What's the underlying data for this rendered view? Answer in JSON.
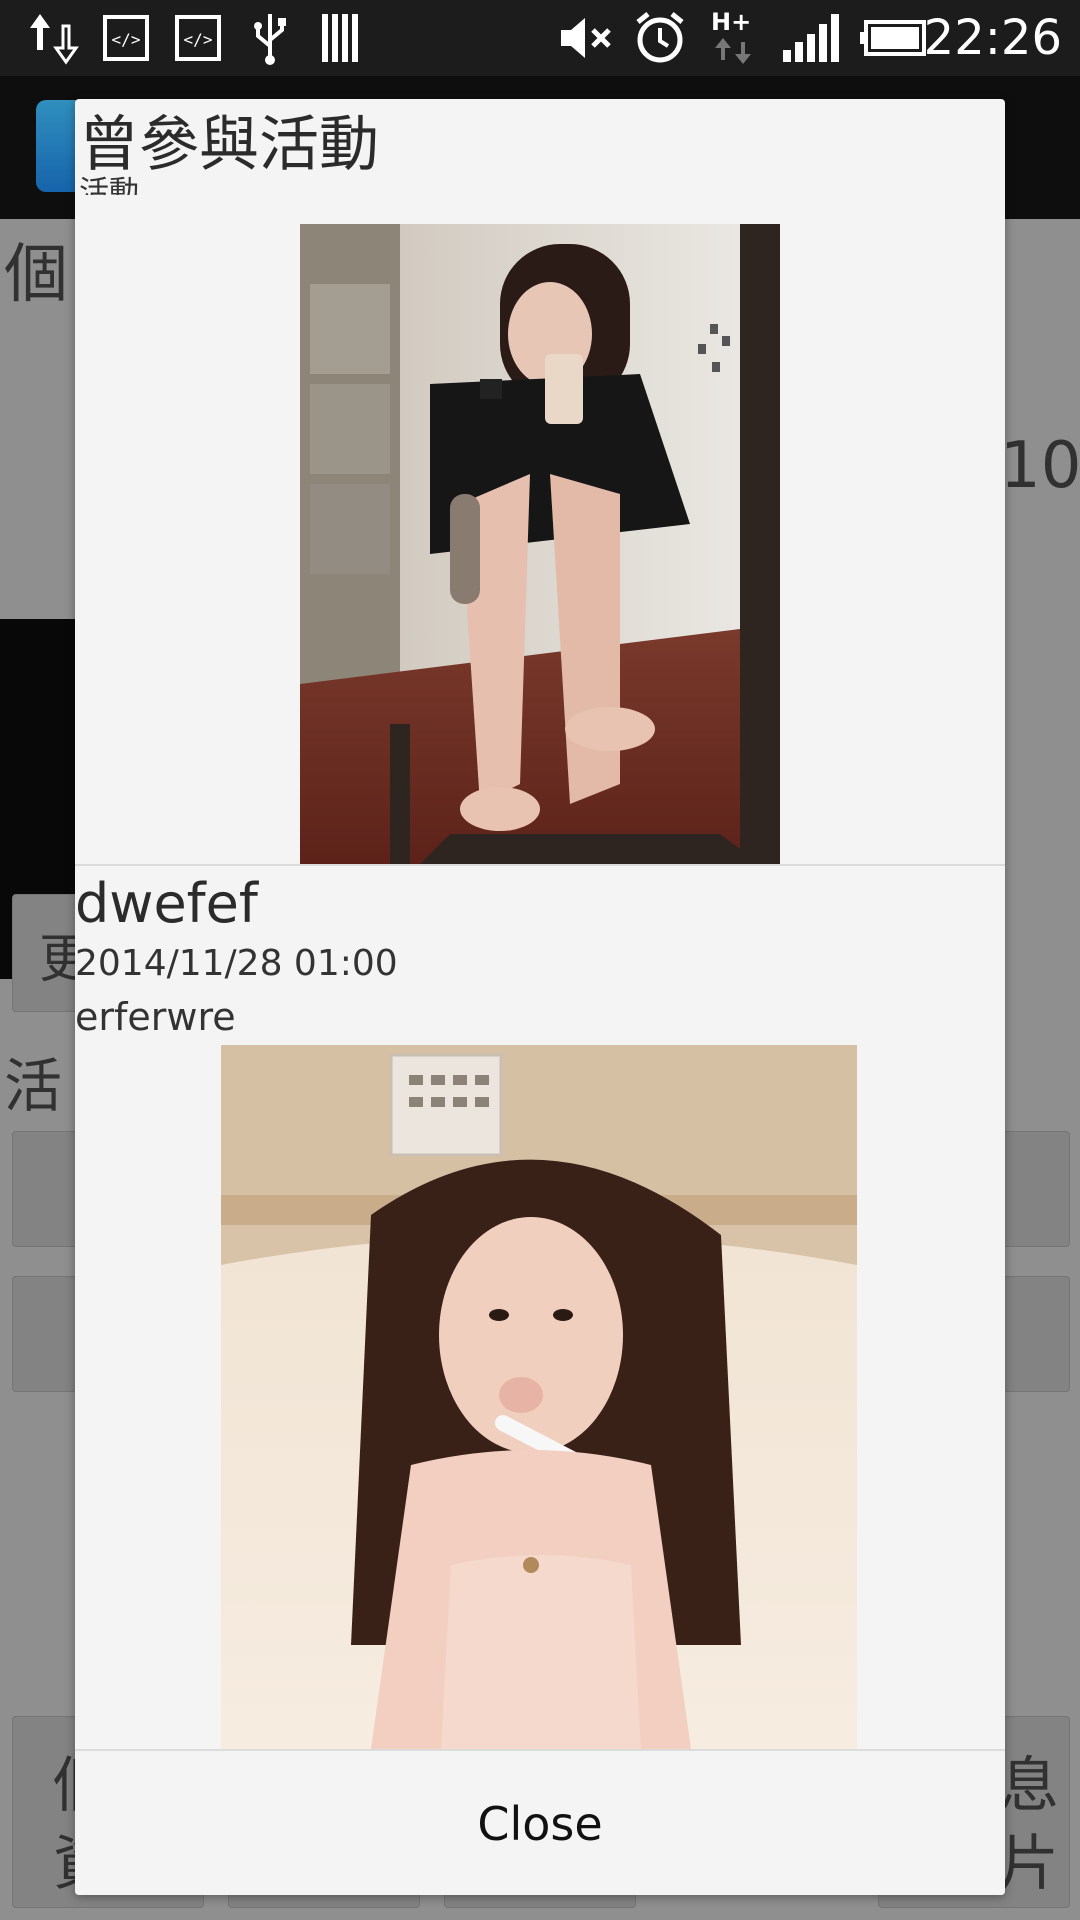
{
  "status_bar": {
    "time": "22:26",
    "icons": [
      "data-transfer-icon",
      "code-icon",
      "code-icon",
      "usb-icon",
      "storage-bars-icon",
      "mute-icon",
      "alarm-icon",
      "hplus-network-icon",
      "signal-icon",
      "battery-icon"
    ]
  },
  "background": {
    "partial_title": "個",
    "partial_number": "10",
    "partial_button_1": "更",
    "partial_section": "活",
    "partial_bottom_left_1": "個",
    "partial_bottom_left_2": "資",
    "partial_bottom_right_1": "息",
    "partial_bottom_right_2": "片"
  },
  "dialog": {
    "title": "曾參與活動",
    "subtitle": "活動",
    "item": {
      "title": "dwefef",
      "datetime": "2014/11/28 01:00",
      "description": "erferwre"
    },
    "close_label": "Close"
  }
}
